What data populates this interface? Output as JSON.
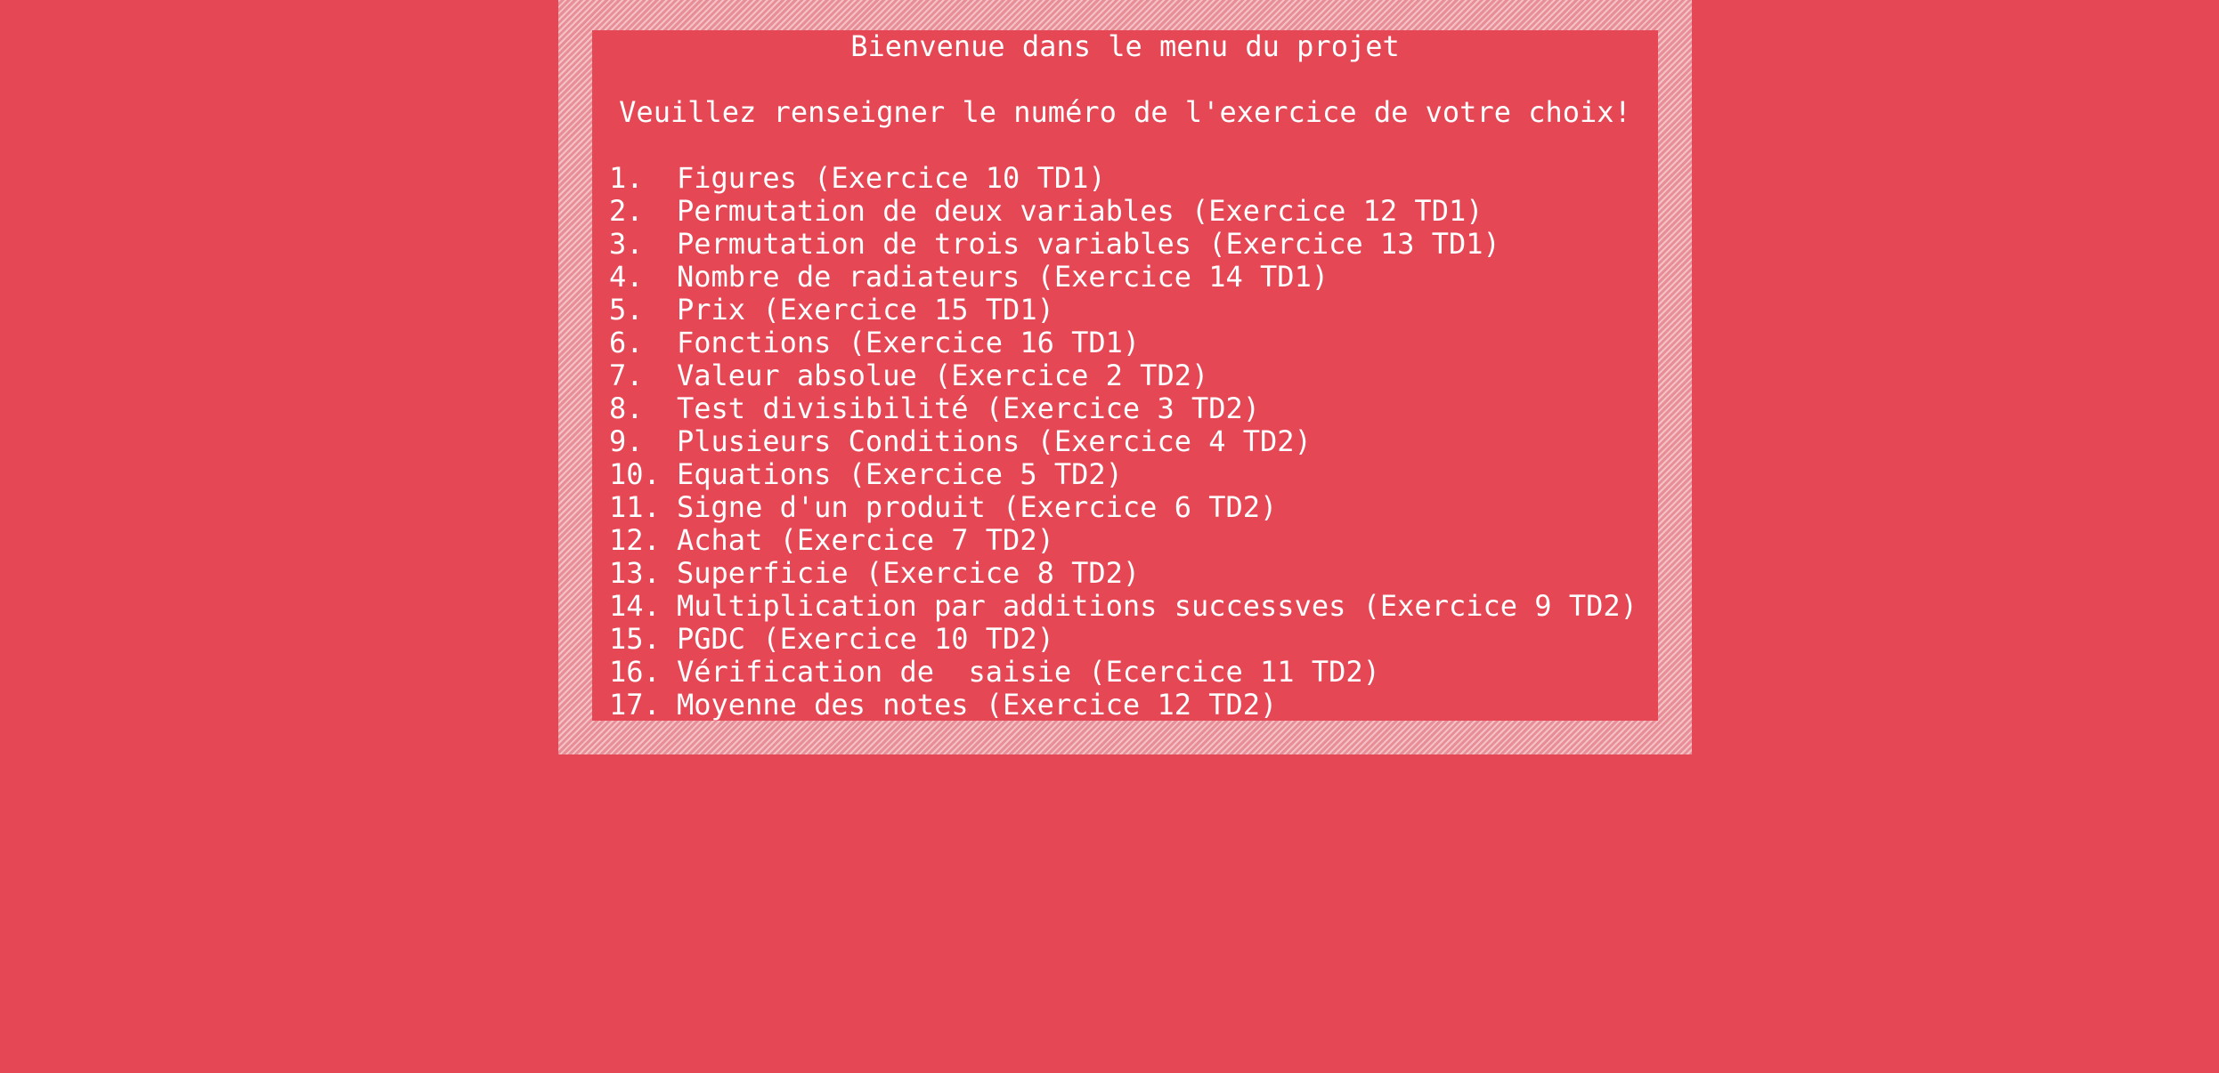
{
  "menu": {
    "title": "Bienvenue dans le menu du projet",
    "prompt": "Veuillez renseigner le numéro de l'exercice de votre choix!",
    "items": [
      {
        "num": "1.",
        "label": "Figures (Exercice 10 TD1)"
      },
      {
        "num": "2.",
        "label": "Permutation de deux variables (Exercice 12 TD1)"
      },
      {
        "num": "3.",
        "label": "Permutation de trois variables (Exercice 13 TD1)"
      },
      {
        "num": "4.",
        "label": "Nombre de radiateurs (Exercice 14 TD1)"
      },
      {
        "num": "5.",
        "label": "Prix (Exercice 15 TD1)"
      },
      {
        "num": "6.",
        "label": "Fonctions (Exercice 16 TD1)"
      },
      {
        "num": "7.",
        "label": "Valeur absolue (Exercice 2 TD2)"
      },
      {
        "num": "8.",
        "label": "Test divisibilité (Exercice 3 TD2)"
      },
      {
        "num": "9.",
        "label": "Plusieurs Conditions (Exercice 4 TD2)"
      },
      {
        "num": "10.",
        "label": "Equations (Exercice 5 TD2)"
      },
      {
        "num": "11.",
        "label": "Signe d'un produit (Exercice 6 TD2)"
      },
      {
        "num": "12.",
        "label": "Achat (Exercice 7 TD2)"
      },
      {
        "num": "13.",
        "label": "Superficie (Exercice 8 TD2)"
      },
      {
        "num": "14.",
        "label": "Multiplication par additions successves (Exercice 9 TD2)"
      },
      {
        "num": "15.",
        "label": "PGDC (Exercice 10 TD2)"
      },
      {
        "num": "16.",
        "label": "Vérification de  saisie (Ecercice 11 TD2)"
      },
      {
        "num": "17.",
        "label": "Moyenne des notes (Exercice 12 TD2)"
      }
    ]
  },
  "colors": {
    "background": "#e54755",
    "text": "#ffffff",
    "border_light": "#f3c1c6",
    "border_dark": "#e88e97"
  }
}
